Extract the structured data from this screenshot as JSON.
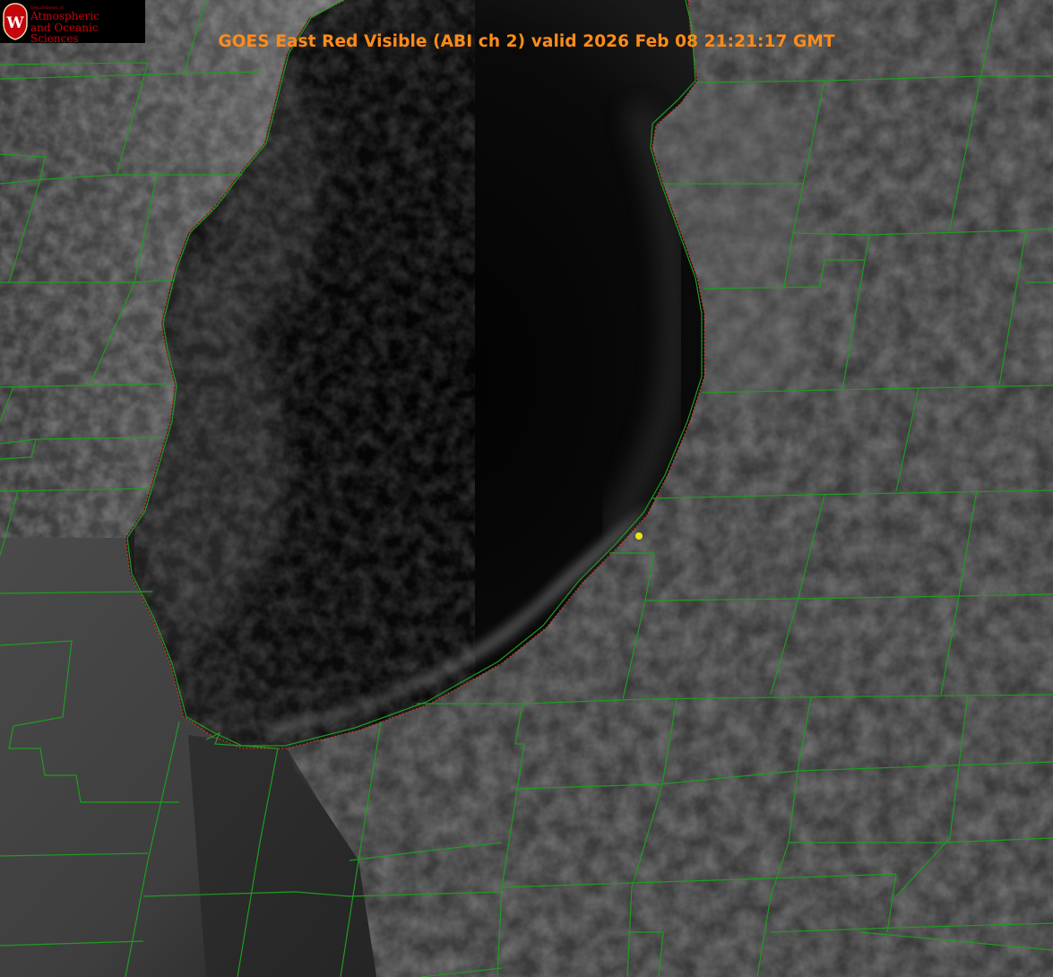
{
  "header": {
    "title": "GOES East Red Visible (ABI ch 2) valid 2026 Feb 08 21:21:17 GMT"
  },
  "logo": {
    "dept_line": "Department of",
    "line1": "Atmospheric",
    "line2": "and Oceanic Sciences",
    "seal_letter": "W",
    "seal_color": "#c5050c"
  },
  "map": {
    "boundary_color": "#1f9c1f",
    "coastline_color": "#e0302a",
    "marker_color": "#e6e619"
  }
}
